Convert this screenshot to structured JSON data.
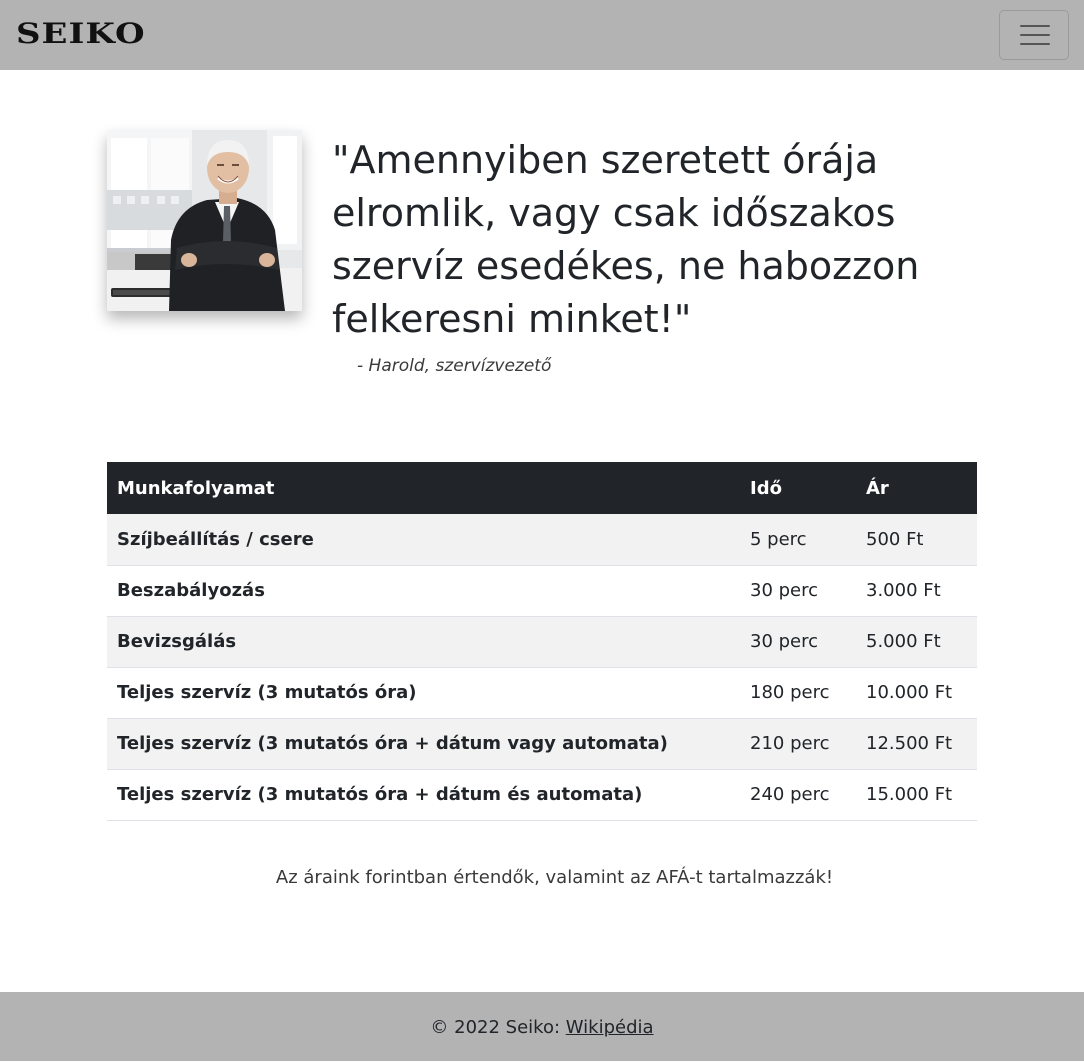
{
  "navbar": {
    "brand": "SEIKO",
    "menu_icon": "hamburger-menu-icon"
  },
  "testimonial": {
    "quote": "\"Amennyiben szeretett órája elromlik, vagy csak időszakos szervíz esedékes, ne habozzon felkeresni minket!\"",
    "author": "- Harold, szervízvezető"
  },
  "price_table": {
    "headers": [
      "Munkafolyamat",
      "Idő",
      "Ár"
    ],
    "rows": [
      {
        "task": "Szíjbeállítás / csere",
        "time": "5 perc",
        "price": "500 Ft"
      },
      {
        "task": "Beszabályozás",
        "time": "30 perc",
        "price": "3.000 Ft"
      },
      {
        "task": "Bevizsgálás",
        "time": "30 perc",
        "price": "5.000 Ft"
      },
      {
        "task": "Teljes szervíz (3 mutatós óra)",
        "time": "180 perc",
        "price": "10.000 Ft"
      },
      {
        "task": "Teljes szervíz (3 mutatós óra + dátum vagy automata)",
        "time": "210 perc",
        "price": "12.500 Ft"
      },
      {
        "task": "Teljes szervíz (3 mutatós óra + dátum és automata)",
        "time": "240 perc",
        "price": "15.000 Ft"
      }
    ]
  },
  "note": "Az áraink forintban értendők, valamint az AFÁ-t tartalmazzák!",
  "footer": {
    "text": "© 2022 Seiko: ",
    "link_label": "Wikipédia"
  },
  "colors": {
    "navbar_bg": "#b3b3b3",
    "table_header_bg": "#212529",
    "stripe_bg": "#f2f2f2"
  }
}
